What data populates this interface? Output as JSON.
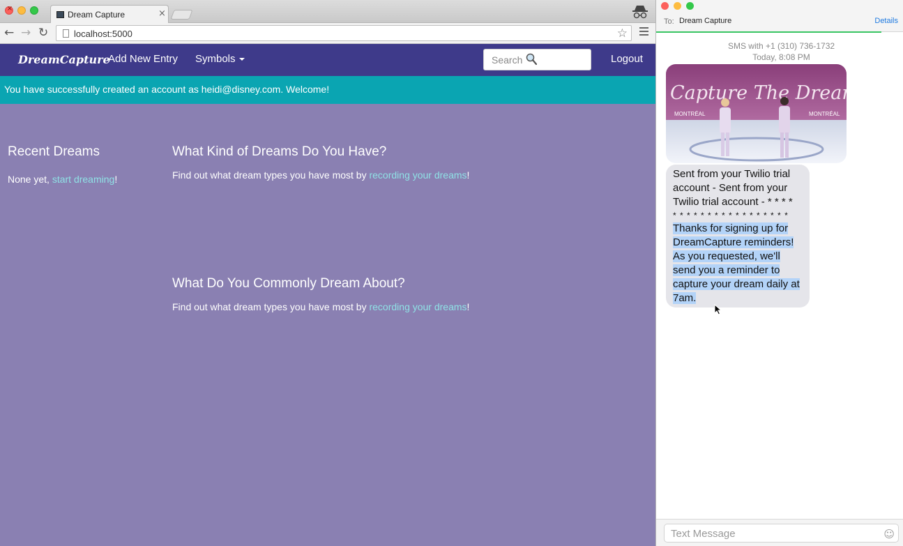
{
  "browser": {
    "tab_title": "Dream Capture",
    "tab_close": "×",
    "url": "localhost:5000",
    "icons": {
      "back": "←",
      "forward": "→",
      "reload": "↻",
      "star": "☆"
    }
  },
  "navbar": {
    "brand": "DreamCapture",
    "add_entry": "Add New Entry",
    "symbols": "Symbols",
    "search_placeholder": "Search",
    "logout": "Logout"
  },
  "flash": {
    "message": "You have successfully created an account as heidi@disney.com. Welcome!"
  },
  "main": {
    "recent": {
      "heading": "Recent Dreams",
      "prefix": "None yet, ",
      "link": "start dreaming",
      "suffix": "!"
    },
    "kinds": {
      "heading": "What Kind of Dreams Do You Have?",
      "prefix": "Find out what dream types you have most by ",
      "link": "recording your dreams",
      "suffix": "!"
    },
    "common": {
      "heading": "What Do You Commonly Dream About?",
      "prefix": "Find out what dream types you have most by ",
      "link": "recording your dreams",
      "suffix": "!"
    }
  },
  "messages": {
    "to_label": "To:",
    "to_name": "Dream Capture",
    "details": "Details",
    "sms_with": "SMS with +1 (310) 736-1732",
    "timestamp": "Today, 8:08 PM",
    "mms_caption": "Capture The Dream!",
    "mms_left": "MONTRÉAL",
    "mms_right": "MONTRÉAL",
    "bubble_line1": "Sent from your Twilio trial account - Sent from your Twilio trial account - * * * *",
    "bubble_stars": "* * * * * * * * * * * * * * * * *",
    "bubble_highlight": "Thanks for signing up for DreamCapture reminders! As you requested, we'll send you a reminder to capture your dream daily at 7am.",
    "input_placeholder": "Text Message",
    "emoji": "☺"
  }
}
